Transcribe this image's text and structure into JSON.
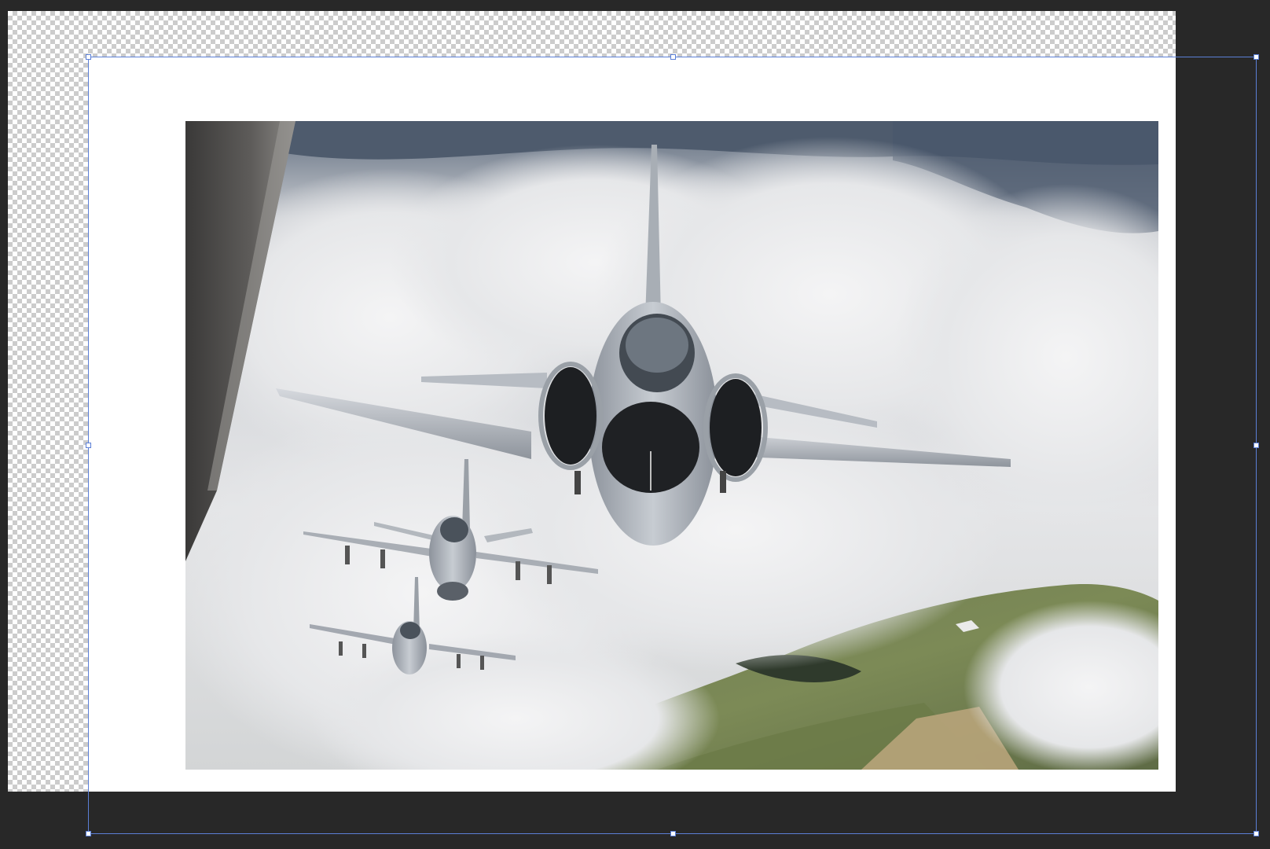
{
  "canvas": {
    "layers": [
      "white-background-layer",
      "fighter-jets-photo-layer"
    ],
    "selection_color": "#5b7fd6",
    "workspace_color": "#282828"
  },
  "photo": {
    "subject": "fighter-jets-formation"
  }
}
